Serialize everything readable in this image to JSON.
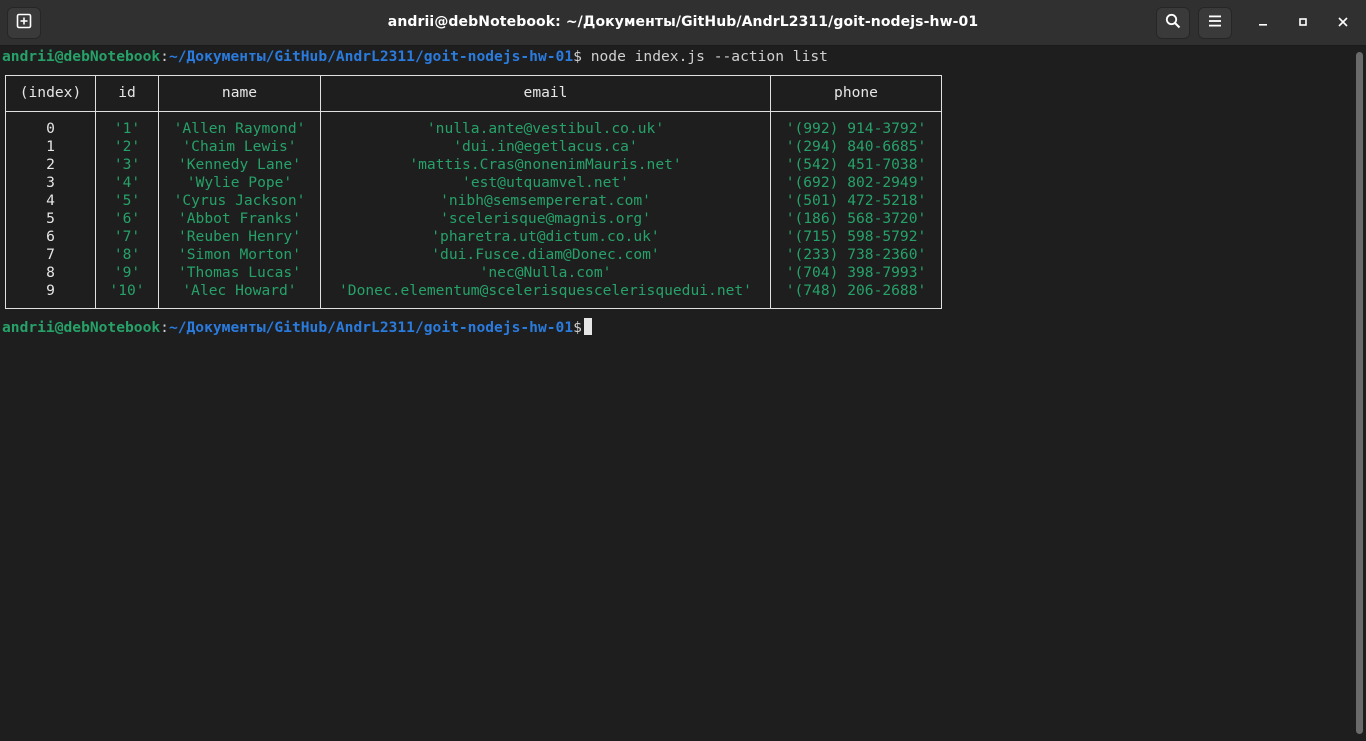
{
  "window": {
    "title": "andrii@debNotebook: ~/Документы/GitHub/AndrL2311/goit-nodejs-hw-01"
  },
  "header": {
    "new_tab_icon": "new-tab-icon",
    "search_icon": "search-icon",
    "menu_icon": "hamburger-menu-icon",
    "minimize_icon": "minimize-icon",
    "maximize_icon": "maximize-icon",
    "close_icon": "close-icon"
  },
  "terminal": {
    "prompt_user": "andrii@debNotebook",
    "prompt_sep": ":",
    "prompt_path": "~/Документы/GitHub/AndrL2311/goit-nodejs-hw-01",
    "prompt_dollar": "$",
    "command": " node index.js --action list",
    "table": {
      "headers": [
        "(index)",
        "id",
        "name",
        "email",
        "phone"
      ],
      "rows": [
        {
          "index": "0",
          "id": "'1'",
          "name": "'Allen Raymond'",
          "email": "'nulla.ante@vestibul.co.uk'",
          "phone": "'(992) 914-3792'"
        },
        {
          "index": "1",
          "id": "'2'",
          "name": "'Chaim Lewis'",
          "email": "'dui.in@egetlacus.ca'",
          "phone": "'(294) 840-6685'"
        },
        {
          "index": "2",
          "id": "'3'",
          "name": "'Kennedy Lane'",
          "email": "'mattis.Cras@nonenimMauris.net'",
          "phone": "'(542) 451-7038'"
        },
        {
          "index": "3",
          "id": "'4'",
          "name": "'Wylie Pope'",
          "email": "'est@utquamvel.net'",
          "phone": "'(692) 802-2949'"
        },
        {
          "index": "4",
          "id": "'5'",
          "name": "'Cyrus Jackson'",
          "email": "'nibh@semsempererat.com'",
          "phone": "'(501) 472-5218'"
        },
        {
          "index": "5",
          "id": "'6'",
          "name": "'Abbot Franks'",
          "email": "'scelerisque@magnis.org'",
          "phone": "'(186) 568-3720'"
        },
        {
          "index": "6",
          "id": "'7'",
          "name": "'Reuben Henry'",
          "email": "'pharetra.ut@dictum.co.uk'",
          "phone": "'(715) 598-5792'"
        },
        {
          "index": "7",
          "id": "'8'",
          "name": "'Simon Morton'",
          "email": "'dui.Fusce.diam@Donec.com'",
          "phone": "'(233) 738-2360'"
        },
        {
          "index": "8",
          "id": "'9'",
          "name": "'Thomas Lucas'",
          "email": "'nec@Nulla.com'",
          "phone": "'(704) 398-7993'"
        },
        {
          "index": "9",
          "id": "'10'",
          "name": "'Alec Howard'",
          "email": "'Donec.elementum@scelerisquescelerisquedui.net'",
          "phone": "'(748) 206-2688'"
        }
      ]
    }
  },
  "colors": {
    "prompt_user": "#26a269",
    "prompt_path": "#2a7bde",
    "string_value": "#26a269",
    "background": "#1e1e1e",
    "headerbar": "#303030"
  }
}
